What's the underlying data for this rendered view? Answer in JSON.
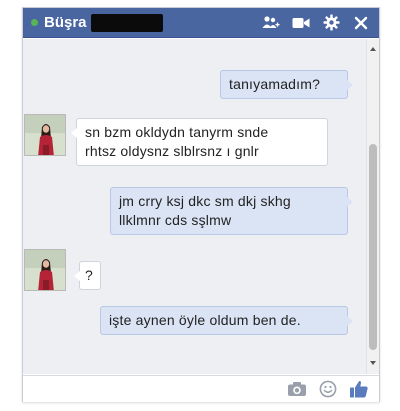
{
  "chat": {
    "contact_name": "Büşra",
    "status_color": "#57b557",
    "header_color": "#4a66a0",
    "header_icons": [
      "add-friends-icon",
      "video-call-icon",
      "gear-icon",
      "close-icon"
    ],
    "footer_icons": [
      "camera-icon",
      "emoji-icon",
      "like-icon"
    ]
  },
  "messages": [
    {
      "direction": "out",
      "lines": [
        "tanıyamadım?"
      ]
    },
    {
      "direction": "in",
      "lines": [
        "sn bzm okldydn tanyrm snde",
        "rhtsz oldysnz slblrsnz ı gnlr"
      ]
    },
    {
      "direction": "out",
      "lines": [
        "jm crry ksj dkc sm dkj skhg",
        "llklmnr cds sşlmw"
      ]
    },
    {
      "direction": "in",
      "lines": [
        "?"
      ]
    },
    {
      "direction": "out",
      "lines": [
        "işte aynen öyle oldum ben de."
      ]
    }
  ]
}
